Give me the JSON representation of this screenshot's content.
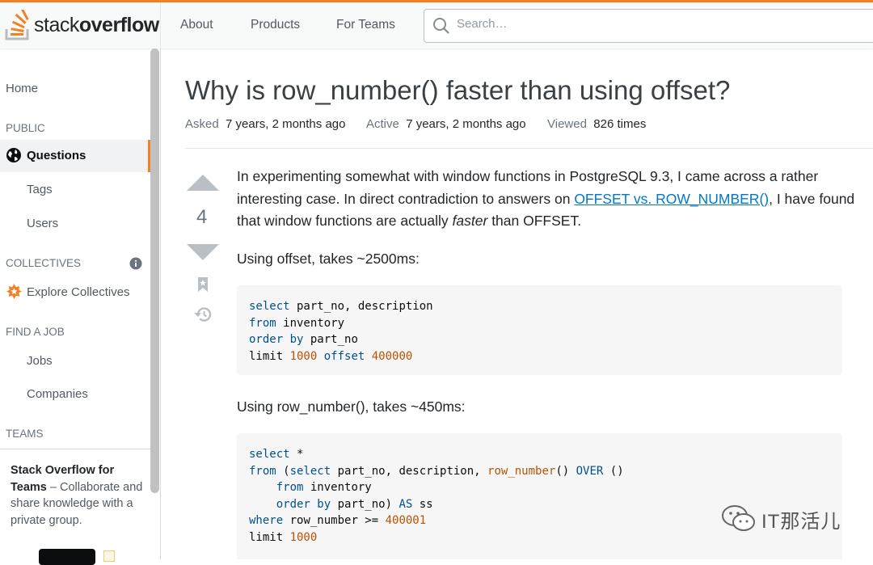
{
  "header": {
    "logo_prefix": "stack",
    "logo_bold": "overflow",
    "nav": [
      "About",
      "Products",
      "For Teams"
    ],
    "search_placeholder": "Search…"
  },
  "sidebar": {
    "home": "Home",
    "public_heading": "PUBLIC",
    "questions": "Questions",
    "tags": "Tags",
    "users": "Users",
    "collectives_heading": "COLLECTIVES",
    "explore_collectives": "Explore Collectives",
    "find_job_heading": "FIND A JOB",
    "jobs": "Jobs",
    "companies": "Companies",
    "teams_heading": "TEAMS",
    "teams_title": "Stack Overflow for Teams",
    "teams_desc": " – Collaborate and share knowledge with a private group."
  },
  "question": {
    "title": "Why is row_number() faster than using offset?",
    "asked_label": "Asked",
    "asked_value": "7 years, 2 months ago",
    "active_label": "Active",
    "active_value": "7 years, 2 months ago",
    "viewed_label": "Viewed",
    "viewed_value": "826 times",
    "votes": "4",
    "p1_a": "In experimenting somewhat with window functions in PostgreSQL 9.3, I came across a rather interesting case. In direct contradiction to answers on ",
    "p1_link": "OFFSET vs. ROW_NUMBER()",
    "p1_b": ", I have found that window functions are actually ",
    "p1_em": "faster",
    "p1_c": " than OFFSET.",
    "p2": "Using offset, takes ~2500ms:",
    "p3": "Using row_number(), takes ~450ms:"
  },
  "code1": {
    "l1_kw": "select",
    "l1_rest": " part_no, description",
    "l2_kw": "from",
    "l2_rest": " inventory",
    "l3_kw": "order by",
    "l3_rest": " part_no",
    "l4_a": "limit ",
    "l4_num1": "1000",
    "l4_kw": " offset ",
    "l4_num2": "400000"
  },
  "code2": {
    "l1_kw": "select",
    "l1_rest": " *",
    "l2_kw": "from",
    "l2_a": " (",
    "l2_kw2": "select",
    "l2_b": " part_no, description, ",
    "l2_fn": "row_number",
    "l2_c": "() ",
    "l2_kw3": "OVER",
    "l2_d": " ()",
    "l3_indent": "    ",
    "l3_kw": "from",
    "l3_rest": " inventory",
    "l4_indent": "    ",
    "l4_kw": "order by",
    "l4_a": " part_no) ",
    "l4_kw2": "AS",
    "l4_rest": " ss",
    "l5_kw": "where",
    "l5_a": " row_number >= ",
    "l5_num": "400001",
    "l6_a": "limit ",
    "l6_num": "1000"
  },
  "watermark": "IT那活儿",
  "colors": {
    "accent": "#f48024",
    "link": "#0077cc",
    "keyword": "#00508f",
    "literal": "#b75301"
  }
}
